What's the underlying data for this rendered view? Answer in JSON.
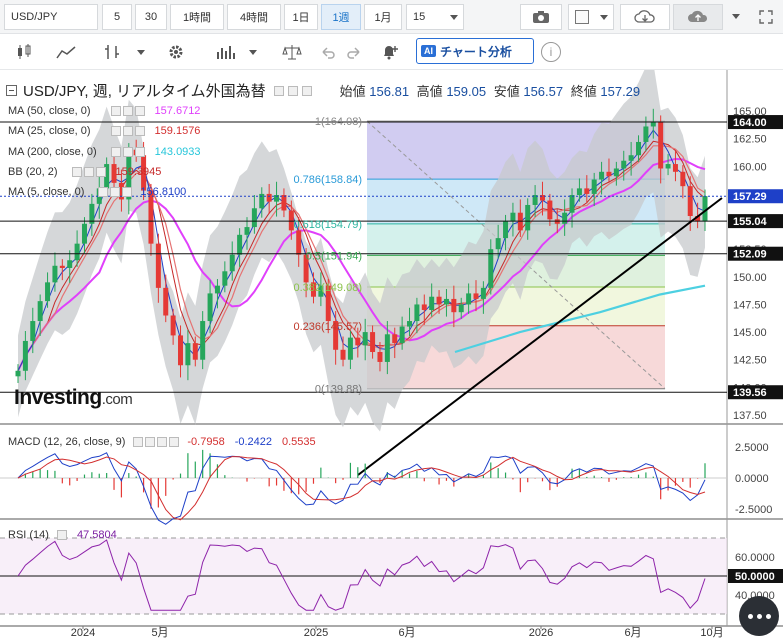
{
  "toolbar": {
    "symbol": "USD/JPY",
    "intervals": [
      "5",
      "30",
      "1時間",
      "4時間",
      "1日",
      "1週",
      "1月"
    ],
    "active_interval": "1週",
    "interval_select": "15",
    "ai_button": "チャート分析",
    "ai_badge": "AI",
    "info": "i"
  },
  "header": {
    "title": "USD/JPY, 週, リアルタイム外国為替",
    "open_label": "始値",
    "open": "156.81",
    "high_label": "高値",
    "high": "159.05",
    "low_label": "安値",
    "low": "156.57",
    "close_label": "終値",
    "close": "157.29"
  },
  "indicators": {
    "ma50": {
      "label": "MA (50, close, 0)",
      "value": "157.6712",
      "color": "#e040fb"
    },
    "ma25": {
      "label": "MA (25, close, 0)",
      "value": "159.1576",
      "color": "#d32f2f"
    },
    "ma200": {
      "label": "MA (200, close, 0)",
      "value": "143.0933",
      "color": "#4dd0e1"
    },
    "bb": {
      "label": "BB (20, 2)",
      "value": "159.3945",
      "color": "#c62828"
    },
    "ma5": {
      "label": "MA (5, close, 0)",
      "value": "156.8100",
      "color": "#1e40c8"
    }
  },
  "fib": {
    "levels": [
      {
        "ratio": "1",
        "label": "1(164.08)",
        "value": 164.08,
        "color": "#888888"
      },
      {
        "ratio": "0.786",
        "label": "0.786(158.84)",
        "value": 158.84,
        "color": "#2a9bd8"
      },
      {
        "ratio": "0.618",
        "label": "0.618(154.79)",
        "value": 154.79,
        "color": "#2bb5a0"
      },
      {
        "ratio": "0.5",
        "label": "0.5(151.94)",
        "value": 151.94,
        "color": "#37a852"
      },
      {
        "ratio": "0.382",
        "label": "0.382(149.08)",
        "value": 149.08,
        "color": "#8bc34a"
      },
      {
        "ratio": "0.236",
        "label": "0.236(145.57)",
        "value": 145.57,
        "color": "#c0392b"
      },
      {
        "ratio": "0",
        "label": "0(139.88)",
        "value": 139.88,
        "color": "#777777"
      }
    ]
  },
  "price_axis": {
    "ticks": [
      "165.00",
      "162.50",
      "160.00",
      "157.50",
      "155.00",
      "152.50",
      "150.00",
      "147.50",
      "145.00",
      "142.50",
      "140.00",
      "137.50"
    ],
    "hlines": [
      {
        "label": "164.00",
        "value": 164.0
      },
      {
        "label": "155.04",
        "value": 155.04
      },
      {
        "label": "152.09",
        "value": 152.09
      },
      {
        "label": "139.56",
        "value": 139.56
      }
    ],
    "current": {
      "label": "157.29",
      "value": 157.29
    }
  },
  "macd": {
    "label": "MACD (12, 26, close, 9)",
    "v1": "-0.7958",
    "v1_color": "#d32f2f",
    "v2": "-0.2422",
    "v2_color": "#1e40c8",
    "v3": "0.5535",
    "v3_color": "#d32f2f",
    "ticks": [
      "2.5000",
      "0.0000",
      "-2.5000"
    ]
  },
  "rsi": {
    "label": "RSI (14)",
    "value": "47.5804",
    "ticks": [
      "60.0000",
      "50.0000",
      "40.0000"
    ],
    "current_label": "50.0000"
  },
  "time_axis": [
    "2024",
    "5月",
    "2025",
    "6月",
    "2026",
    "6月",
    "10月"
  ],
  "logo": {
    "main": "Investing",
    "suffix": ".com"
  },
  "chart_data": {
    "type": "candlestick",
    "title": "USD/JPY, 週, リアルタイム外国為替",
    "ylim": [
      137.5,
      165
    ],
    "x_labels": [
      "2024",
      "5月",
      "2025",
      "6月",
      "2026",
      "6月",
      "10月"
    ],
    "close_path": [
      141.5,
      144.2,
      146.0,
      147.8,
      149.5,
      151.0,
      150.8,
      151.5,
      153.0,
      154.8,
      156.6,
      158.0,
      160.2,
      158.5,
      157.0,
      161.5,
      161.0,
      157.8,
      153.0,
      149.0,
      146.5,
      144.7,
      142.0,
      144.0,
      142.5,
      146.0,
      148.5,
      149.2,
      150.5,
      152.0,
      153.8,
      154.5,
      156.2,
      157.5,
      156.8,
      157.4,
      156.0,
      154.2,
      152.0,
      149.5,
      148.2,
      149.2,
      146.0,
      143.4,
      142.5,
      144.5,
      143.8,
      145.0,
      143.2,
      142.3,
      144.8,
      144.0,
      145.5,
      146.0,
      147.5,
      147.0,
      148.2,
      147.5,
      148.0,
      146.8,
      147.5,
      148.5,
      148.0,
      149.0,
      152.5,
      153.5,
      155.0,
      155.8,
      154.2,
      156.5,
      157.4,
      156.9,
      155.2,
      154.8,
      155.8,
      157.4,
      158.0,
      157.5,
      158.8,
      159.5,
      159.1,
      159.8,
      160.5,
      161.0,
      162.2,
      163.6,
      164.0,
      159.8,
      160.2,
      159.5,
      158.2,
      155.5,
      155.0,
      157.3
    ],
    "ma5": 156.81,
    "ma25": 159.1576,
    "ma50": 157.6712,
    "ma200": 143.0933,
    "bb": 159.3945,
    "macd": {
      "macd": -0.2422,
      "signal": -0.7958,
      "hist": 0.5535,
      "ylim": [
        -2.5,
        2.5
      ]
    },
    "rsi": {
      "value": 47.5804,
      "ylim": [
        30,
        70
      ]
    }
  }
}
